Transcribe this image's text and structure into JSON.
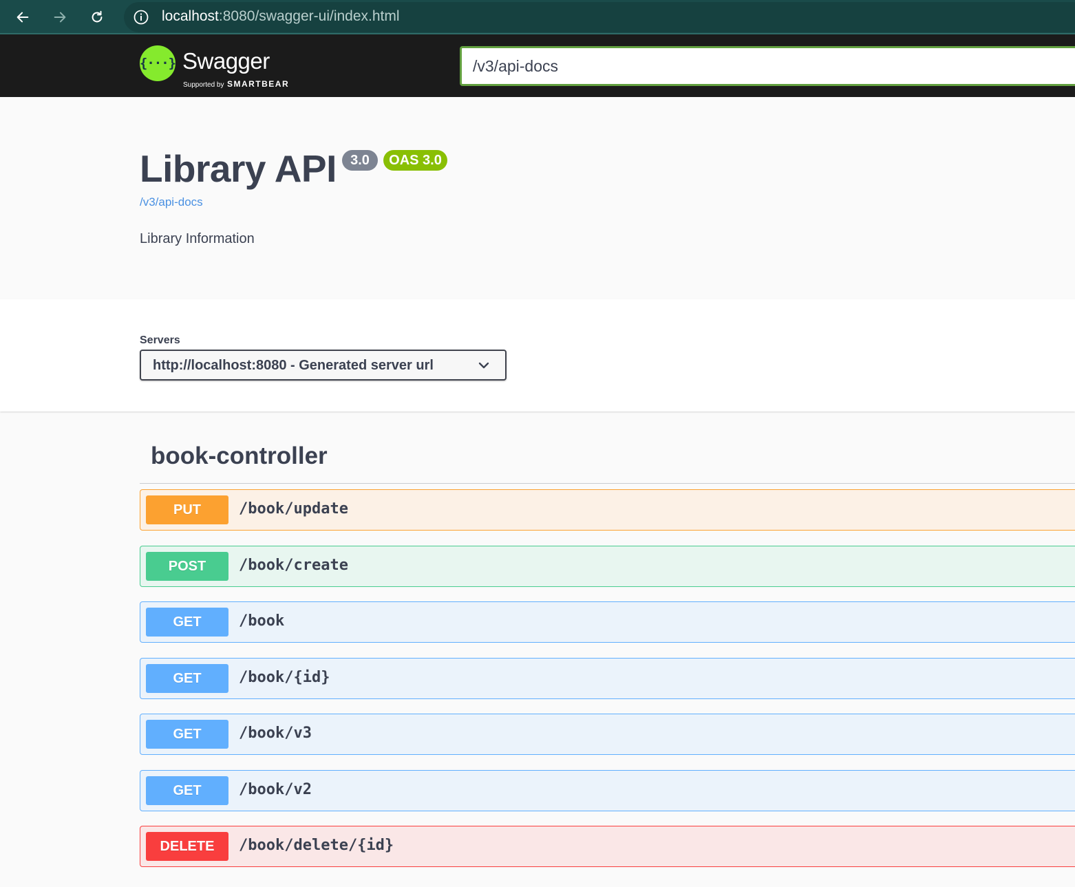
{
  "browser": {
    "url_host": "localhost",
    "url_rest": ":8080/swagger-ui/index.html"
  },
  "topbar": {
    "logo_text": "Swagger",
    "supported_by": "Supported by",
    "brand": "SMARTBEAR",
    "spec_url_value": "/v3/api-docs"
  },
  "info": {
    "title": "Library API",
    "version_badge": "3.0",
    "oas_badge": "OAS 3.0",
    "spec_link": "/v3/api-docs",
    "description": "Library Information"
  },
  "servers": {
    "label": "Servers",
    "selected": "http://localhost:8080 - Generated server url"
  },
  "controller": {
    "name": "book-controller",
    "operations": [
      {
        "method": "PUT",
        "path": "/book/update"
      },
      {
        "method": "POST",
        "path": "/book/create"
      },
      {
        "method": "GET",
        "path": "/book"
      },
      {
        "method": "GET",
        "path": "/book/{id}"
      },
      {
        "method": "GET",
        "path": "/book/v3"
      },
      {
        "method": "GET",
        "path": "/book/v2"
      },
      {
        "method": "DELETE",
        "path": "/book/delete/{id}"
      }
    ]
  },
  "colors": {
    "put": "#fca130",
    "post": "#49cc90",
    "get": "#61affe",
    "delete": "#f93e3e",
    "oas_badge": "#89bf04",
    "logo": "#85ea2d",
    "link": "#4990e2"
  },
  "icons": [
    "back-arrow-icon",
    "forward-arrow-icon",
    "reload-icon",
    "site-info-icon",
    "swagger-logo-icon",
    "chevron-down-icon"
  ]
}
